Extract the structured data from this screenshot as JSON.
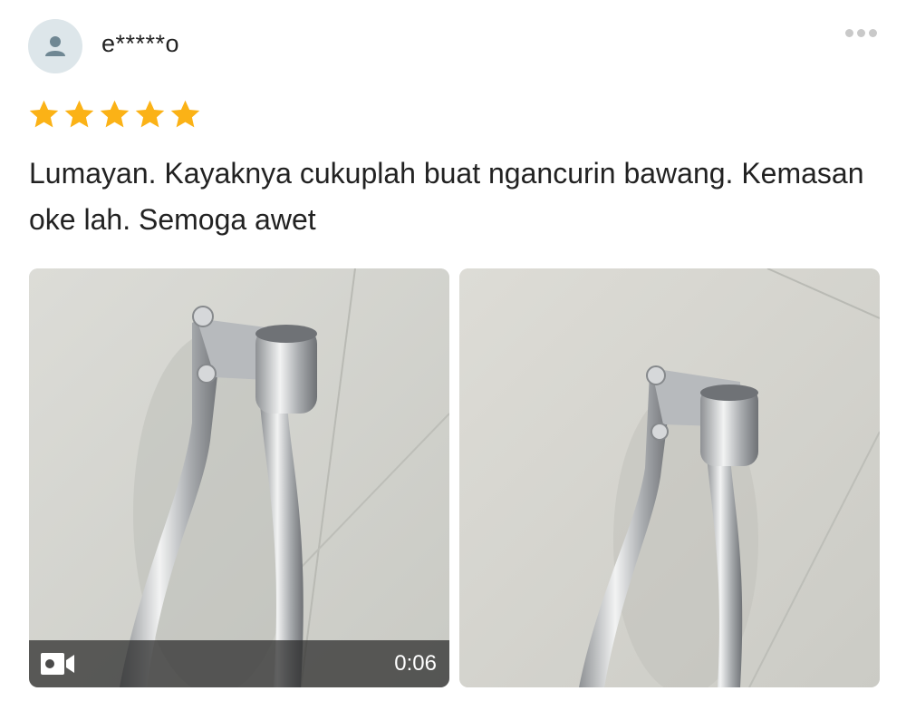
{
  "reviewer": {
    "avatar_icon": "user-icon",
    "name": "e*****o"
  },
  "menu": {
    "icon": "more-horizontal-icon"
  },
  "rating": {
    "value": 5,
    "max": 5,
    "star_color": "#fbb216"
  },
  "review": {
    "text": "Lumayan. Kayaknya cukuplah buat ngancurin bawang. Kemasan oke lah. Semoga awet"
  },
  "media": [
    {
      "type": "video",
      "icon": "video-camera-icon",
      "duration": "0:06"
    },
    {
      "type": "photo"
    }
  ]
}
